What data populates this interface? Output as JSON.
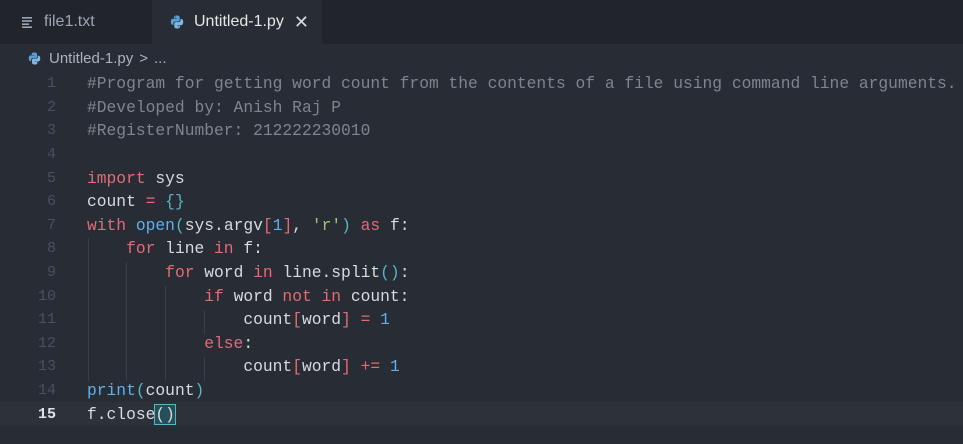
{
  "tabs": [
    {
      "label": "file1.txt",
      "icon": "lines-icon",
      "active": false
    },
    {
      "label": "Untitled-1.py",
      "icon": "python-icon",
      "active": true,
      "close": "✕"
    }
  ],
  "breadcrumb": {
    "file": "Untitled-1.py",
    "separator": ">",
    "more": "..."
  },
  "line_numbers": [
    "1",
    "2",
    "3",
    "4",
    "5",
    "6",
    "7",
    "8",
    "9",
    "10",
    "11",
    "12",
    "13",
    "14",
    "15"
  ],
  "code": {
    "l1": "#Program for getting word count from the contents of a file using command line arguments.",
    "l2": "#Developed by: Anish Raj P",
    "l3": "#RegisterNumber: 212222230010",
    "l5_kw": "import",
    "l5_rest": " sys",
    "l6_a": "count",
    "l6_op": " = ",
    "l6_br": "{}",
    "l7_kw": "with",
    "l7_fn": " open",
    "l7_p1": "(",
    "l7_a": "sys.argv",
    "l7_b1": "[",
    "l7_n": "1",
    "l7_b2": "]",
    "l7_c": ", ",
    "l7_s": "'r'",
    "l7_p2": ")",
    "l7_as": " as",
    "l7_f": " f:",
    "l8_kw": "for",
    "l8_a": " line ",
    "l8_in": "in",
    "l8_b": " f:",
    "l9_kw": "for",
    "l9_a": " word ",
    "l9_in": "in",
    "l9_b": " line.split",
    "l9_p": "()",
    "l9_c": ":",
    "l10_kw": "if",
    "l10_a": " word ",
    "l10_not": "not",
    "l10_sp": " ",
    "l10_in": "in",
    "l10_b": " count:",
    "l11_a": "count",
    "l11_b1": "[",
    "l11_w": "word",
    "l11_b2": "]",
    "l11_op": " = ",
    "l11_n": "1",
    "l12_kw": "else",
    "l12_c": ":",
    "l13_a": "count",
    "l13_b1": "[",
    "l13_w": "word",
    "l13_b2": "]",
    "l13_op": " += ",
    "l13_n": "1",
    "l14_fn": "print",
    "l14_p1": "(",
    "l14_a": "count",
    "l14_p2": ")",
    "l15_a": "f.close",
    "l15_p": "()"
  },
  "colors": {
    "keyword": "#e06c75",
    "function": "#61afef",
    "string": "#98c379",
    "comment": "#7f848e",
    "bracket": "#56b6c2"
  }
}
